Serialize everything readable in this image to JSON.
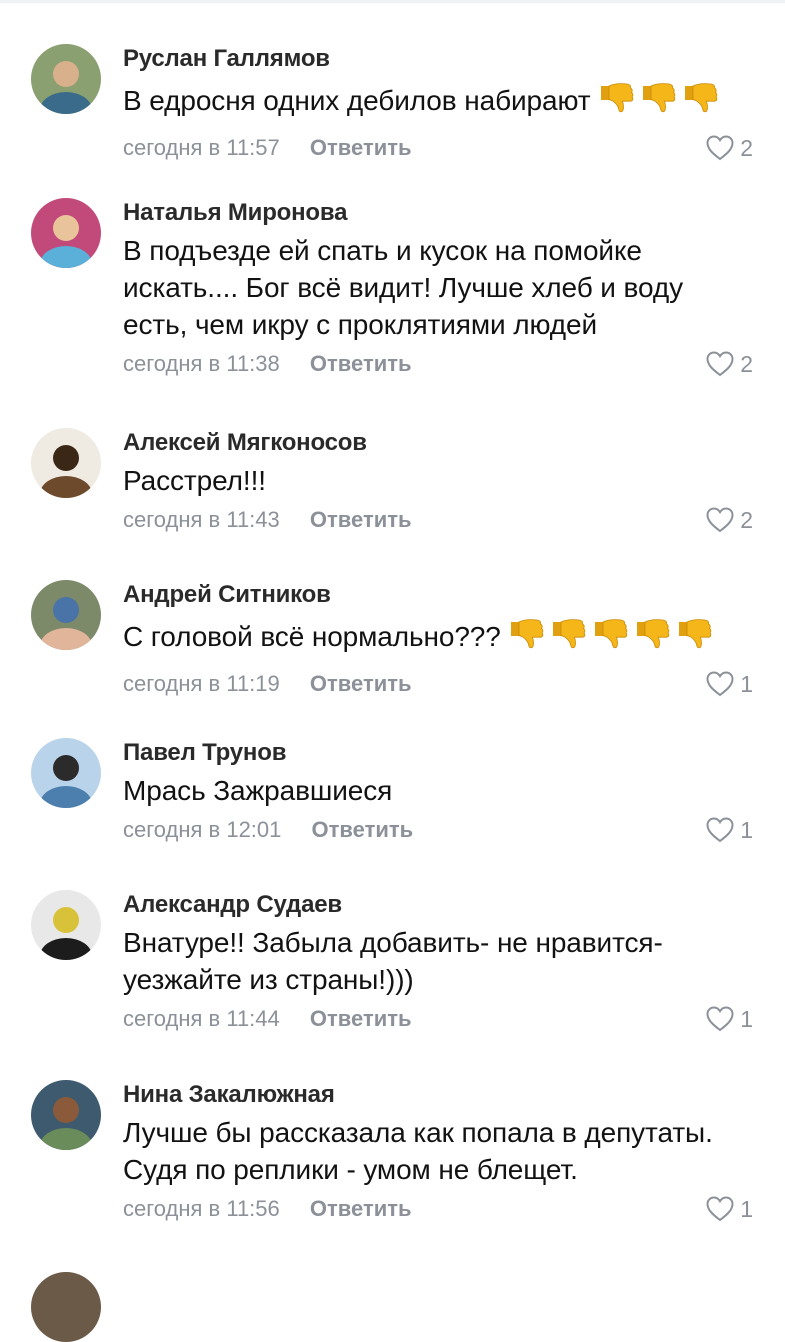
{
  "comments": [
    {
      "author": "Руслан Галлямов",
      "text": "В едросня одних дебилов набирают",
      "emoji_name": "thumbs-down",
      "emoji_count": 3,
      "time": "сегодня в 11:57",
      "reply_label": "Ответить",
      "likes": "2",
      "avatar_colors": [
        "#8aa070",
        "#3a6b8a",
        "#d9b08c"
      ]
    },
    {
      "author": "Наталья Миронова",
      "text": "В подъезде ей спать и кусок на помойке\nискать....  Бог всё видит!  Лучше хлеб и воду\nесть, чем икру с проклятиями людей",
      "emoji_name": "",
      "emoji_count": 0,
      "time": "сегодня в 11:38",
      "reply_label": "Ответить",
      "likes": "2",
      "avatar_colors": [
        "#c24a7a",
        "#5ab0d8",
        "#e9c39a"
      ]
    },
    {
      "author": "Алексей Мягконосов",
      "text": "Расстрел!!!",
      "emoji_name": "",
      "emoji_count": 0,
      "time": "сегодня в 11:43",
      "reply_label": "Ответить",
      "likes": "2",
      "avatar_colors": [
        "#efeae2",
        "#6e4a2c",
        "#3b2716"
      ]
    },
    {
      "author": "Андрей Ситников",
      "text": "С головой всё нормально???",
      "emoji_name": "thumbs-down",
      "emoji_count": 5,
      "time": "сегодня в 11:19",
      "reply_label": "Ответить",
      "likes": "1",
      "avatar_colors": [
        "#7c8a6a",
        "#e0b59a",
        "#4a73a8"
      ]
    },
    {
      "author": "Павел Трунов",
      "text": "Мрась  Зажравшиеся",
      "emoji_name": "",
      "emoji_count": 0,
      "time": "сегодня в 12:01",
      "reply_label": "Ответить",
      "likes": "1",
      "avatar_colors": [
        "#b9d4ea",
        "#4d7fae",
        "#2b2b2b"
      ]
    },
    {
      "author": "Александр Судаев",
      "text": "Внатуре!! Забыла добавить- не нравится-\nуезжайте из страны!)))",
      "emoji_name": "",
      "emoji_count": 0,
      "time": "сегодня в 11:44",
      "reply_label": "Ответить",
      "likes": "1",
      "avatar_colors": [
        "#e8e8e8",
        "#1c1c1c",
        "#d8c23a"
      ]
    },
    {
      "author": "Нина Закалюжная",
      "text": "Лучше бы рассказала как попала в депутаты.\nСудя по реплики  - умом не блещет.",
      "emoji_name": "",
      "emoji_count": 0,
      "time": "сегодня в 11:56",
      "reply_label": "Ответить",
      "likes": "1",
      "avatar_colors": [
        "#3d5a6e",
        "#6a8b5a",
        "#8a5a3a"
      ]
    }
  ],
  "colors": {
    "meta": "#8c9199",
    "author": "#2a2a2a",
    "text": "#121212",
    "emoji": "#f5b619"
  },
  "icons": {
    "like": "heart-outline-icon",
    "emoji": "thumbs-down-emoji"
  }
}
